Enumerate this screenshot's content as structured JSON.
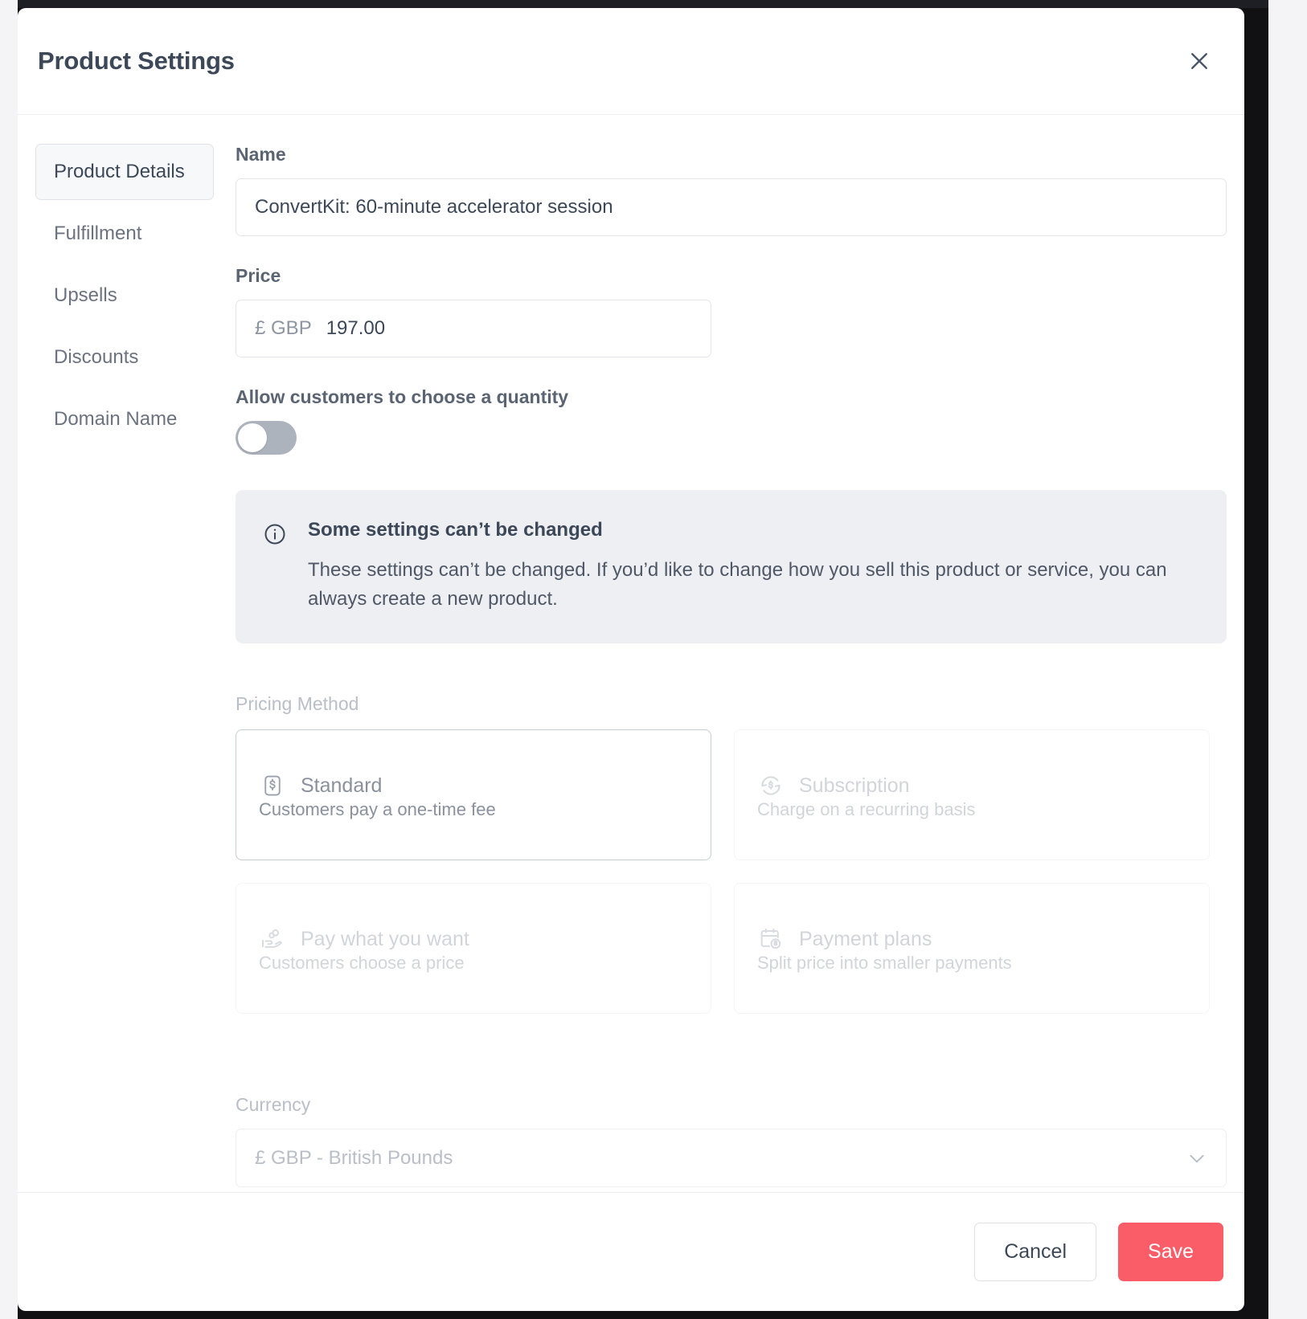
{
  "modal": {
    "title": "Product Settings",
    "close_icon": "close-icon"
  },
  "sidebar": {
    "items": [
      {
        "label": "Product Details",
        "active": true
      },
      {
        "label": "Fulfillment",
        "active": false
      },
      {
        "label": "Upsells",
        "active": false
      },
      {
        "label": "Discounts",
        "active": false
      },
      {
        "label": "Domain Name",
        "active": false
      }
    ]
  },
  "form": {
    "name": {
      "label": "Name",
      "value": "ConvertKit: 60-minute accelerator session",
      "placeholder": "Product name"
    },
    "price": {
      "label": "Price",
      "currency_prefix": "£ GBP",
      "value": "197.00",
      "placeholder": "0.00"
    },
    "quantity_toggle": {
      "label": "Allow customers to choose a quantity",
      "state": "off"
    },
    "info_banner": {
      "icon": "info-circle-icon",
      "title": "Some settings can’t be changed",
      "body": "These settings can’t be changed. If you’d like to change how you sell this product or service, you can always create a new product."
    },
    "pricing_method": {
      "label": "Pricing Method",
      "options": [
        {
          "title": "Standard",
          "description": "Customers pay a one-time fee",
          "icon": "dollar-square-icon",
          "selected": true,
          "disabled": false
        },
        {
          "title": "Subscription",
          "description": "Charge on a recurring basis",
          "icon": "recurring-dollar-icon",
          "selected": false,
          "disabled": true
        },
        {
          "title": "Pay what you want",
          "description": "Customers choose a price",
          "icon": "hand-coins-icon",
          "selected": false,
          "disabled": true
        },
        {
          "title": "Payment plans",
          "description": "Split price into smaller payments",
          "icon": "calendar-dollar-icon",
          "selected": false,
          "disabled": true
        }
      ]
    },
    "currency": {
      "label": "Currency",
      "selected": "£ GBP - British Pounds",
      "chevron_icon": "chevron-down-icon"
    }
  },
  "footer": {
    "cancel_label": "Cancel",
    "save_label": "Save"
  },
  "colors": {
    "accent_save": "#fa5d67",
    "title_text": "#3c4858",
    "muted_text": "#b9bec7",
    "banner_bg": "#eeeff3",
    "toggle_off_track": "#adb3bd"
  }
}
